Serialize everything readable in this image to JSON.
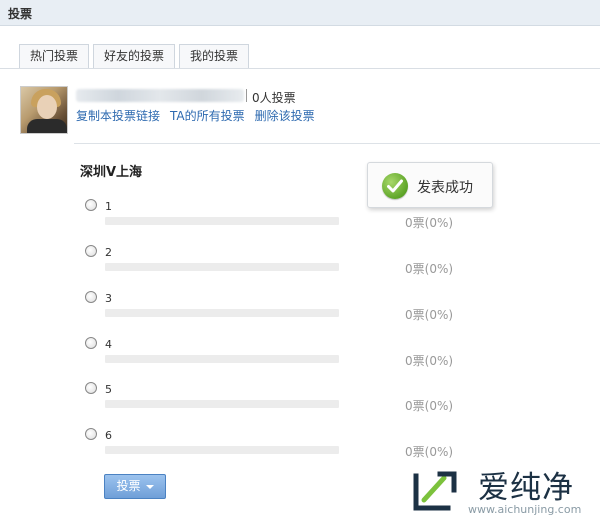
{
  "header": {
    "title": "投票"
  },
  "tabs": [
    {
      "label": "热门投票"
    },
    {
      "label": "好友的投票"
    },
    {
      "label": "我的投票"
    }
  ],
  "poll_info": {
    "vote_count": "0人投票",
    "links": [
      {
        "label": "复制本投票链接"
      },
      {
        "label": "TA的所有投票"
      },
      {
        "label": "删除该投票"
      }
    ]
  },
  "poll": {
    "title": "深圳V上海",
    "options": [
      {
        "label": "1",
        "result": "0票(0%)",
        "percent": 0
      },
      {
        "label": "2",
        "result": "0票(0%)",
        "percent": 0
      },
      {
        "label": "3",
        "result": "0票(0%)",
        "percent": 0
      },
      {
        "label": "4",
        "result": "0票(0%)",
        "percent": 0
      },
      {
        "label": "5",
        "result": "0票(0%)",
        "percent": 0
      },
      {
        "label": "6",
        "result": "0票(0%)",
        "percent": 0
      }
    ],
    "vote_button": "投票"
  },
  "toast": {
    "message": "发表成功",
    "icon": "check-icon",
    "color": "#5ea528"
  },
  "watermark": {
    "text": "爱纯净",
    "url": "www.aichunjing.com"
  },
  "colors": {
    "link": "#2e6ab0",
    "button": "#6f9fd8",
    "topbar": "#e8eef4"
  }
}
